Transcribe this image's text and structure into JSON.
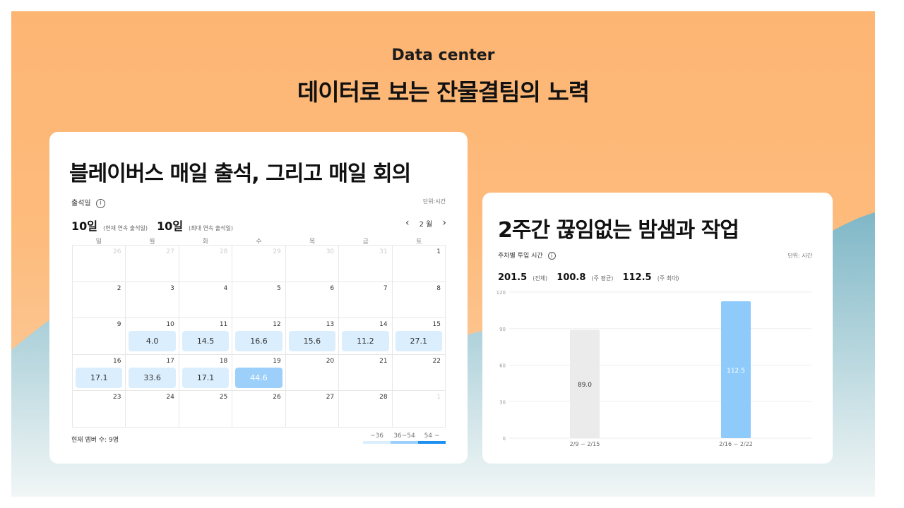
{
  "hero": {
    "subtitle": "Data center",
    "title": "데이터로 보는 잔물결팀의 노력"
  },
  "attendance_card": {
    "title": "블레이버스 매일 출석, 그리고 매일 회의",
    "section_label": "출석일",
    "unit_label": "단위:시간",
    "current_streak_value": "10일",
    "current_streak_label": "(현재 연속 출석일)",
    "max_streak_value": "10일",
    "max_streak_label": "(최대 연속 출석일)",
    "month_label": "2 월",
    "weekdays": [
      "일",
      "월",
      "화",
      "수",
      "목",
      "금",
      "토"
    ],
    "days": [
      {
        "day": "26",
        "muted": true,
        "value": "",
        "level": 0
      },
      {
        "day": "27",
        "muted": true,
        "value": "",
        "level": 0
      },
      {
        "day": "28",
        "muted": true,
        "value": "",
        "level": 0
      },
      {
        "day": "29",
        "muted": true,
        "value": "",
        "level": 0
      },
      {
        "day": "30",
        "muted": true,
        "value": "",
        "level": 0
      },
      {
        "day": "31",
        "muted": true,
        "value": "",
        "level": 0
      },
      {
        "day": "1",
        "muted": false,
        "value": "",
        "level": 0
      },
      {
        "day": "2",
        "muted": false,
        "value": "",
        "level": 0
      },
      {
        "day": "3",
        "muted": false,
        "value": "",
        "level": 0
      },
      {
        "day": "4",
        "muted": false,
        "value": "",
        "level": 0
      },
      {
        "day": "5",
        "muted": false,
        "value": "",
        "level": 0
      },
      {
        "day": "6",
        "muted": false,
        "value": "",
        "level": 0
      },
      {
        "day": "7",
        "muted": false,
        "value": "",
        "level": 0
      },
      {
        "day": "8",
        "muted": false,
        "value": "",
        "level": 0
      },
      {
        "day": "9",
        "muted": false,
        "value": "",
        "level": 0
      },
      {
        "day": "10",
        "muted": false,
        "value": "4.0",
        "level": 1
      },
      {
        "day": "11",
        "muted": false,
        "value": "14.5",
        "level": 1
      },
      {
        "day": "12",
        "muted": false,
        "value": "16.6",
        "level": 1
      },
      {
        "day": "13",
        "muted": false,
        "value": "15.6",
        "level": 1
      },
      {
        "day": "14",
        "muted": false,
        "value": "11.2",
        "level": 1
      },
      {
        "day": "15",
        "muted": false,
        "value": "27.1",
        "level": 1
      },
      {
        "day": "16",
        "muted": false,
        "value": "17.1",
        "level": 1
      },
      {
        "day": "17",
        "muted": false,
        "value": "33.6",
        "level": 1
      },
      {
        "day": "18",
        "muted": false,
        "value": "17.1",
        "level": 1
      },
      {
        "day": "19",
        "muted": false,
        "value": "44.6",
        "level": 2
      },
      {
        "day": "20",
        "muted": false,
        "value": "",
        "level": 0
      },
      {
        "day": "21",
        "muted": false,
        "value": "",
        "level": 0
      },
      {
        "day": "22",
        "muted": false,
        "value": "",
        "level": 0
      },
      {
        "day": "23",
        "muted": false,
        "value": "",
        "level": 0
      },
      {
        "day": "24",
        "muted": false,
        "value": "",
        "level": 0
      },
      {
        "day": "25",
        "muted": false,
        "value": "",
        "level": 0
      },
      {
        "day": "26",
        "muted": false,
        "value": "",
        "level": 0
      },
      {
        "day": "27",
        "muted": false,
        "value": "",
        "level": 0
      },
      {
        "day": "28",
        "muted": false,
        "value": "",
        "level": 0
      },
      {
        "day": "1",
        "muted": true,
        "value": "",
        "level": 0
      }
    ],
    "member_count": "현재 멤버 수: 9명",
    "legend": [
      {
        "label": "~36",
        "color": "#dbeefd"
      },
      {
        "label": "36~54",
        "color": "#9cd0fb"
      },
      {
        "label": "54 ~",
        "color": "#1e90f0"
      }
    ]
  },
  "work_card": {
    "title": "2주간 끊임없는 밤샘과 작업",
    "section_label": "주차별 투입 시간",
    "unit_label": "단위: 시간",
    "stats": [
      {
        "value": "201.5",
        "label": "(전체)"
      },
      {
        "value": "100.8",
        "label": "(주 평균)"
      },
      {
        "value": "112.5",
        "label": "(주 최대)"
      }
    ]
  },
  "chart_data": {
    "type": "bar",
    "categories": [
      "2/9 ~ 2/15",
      "2/16 ~ 2/22"
    ],
    "values": [
      89.0,
      112.5
    ],
    "value_labels": [
      "89.0",
      "112.5"
    ],
    "bar_colors": [
      "#ebebeb",
      "#8ecbfb"
    ],
    "value_label_colors": [
      "#333333",
      "#ffffff"
    ],
    "yticks": [
      "0",
      "30",
      "60",
      "90",
      "120"
    ],
    "ylim": [
      0,
      120
    ],
    "grid": true
  },
  "colors": {
    "background_orange": "#fdb573",
    "background_teal": "#86bcc9",
    "accent_blue": "#1e90f0"
  }
}
